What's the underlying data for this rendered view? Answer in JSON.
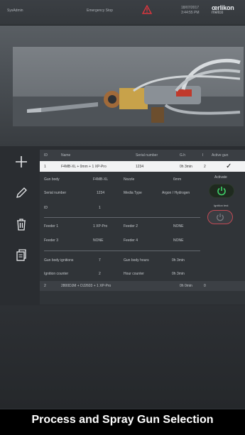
{
  "topbar": {
    "user": "SysAdmin",
    "emergency": "Emergency Stop",
    "date": "18/07/2017",
    "time": "3:44:55 PM",
    "logo_main": "œrlikon",
    "logo_sub": "metco"
  },
  "table": {
    "headers": {
      "id": "ID",
      "name": "Name",
      "serial": "Serial number",
      "hours": "G.h",
      "i": "I",
      "active": "Active gun"
    },
    "rows": [
      {
        "id": "1",
        "name": "F4MB-XL + 0mm + 1 XP-Pro",
        "serial": "1234",
        "hours": "0h 3min",
        "i": "2",
        "active": "✓"
      },
      {
        "id": "2",
        "name": "2800DJM + DJ2603 + 1 XP-Pro",
        "serial": "",
        "hours": "0h 0min",
        "i": "0",
        "active": ""
      }
    ]
  },
  "detail": {
    "gun_body_label": "Gun body",
    "gun_body_value": "F4MB-XL",
    "nozzle_label": "Nozzle",
    "nozzle_value": "6mm",
    "serial_label": "Serial number",
    "serial_value": "1234",
    "media_label": "Media Type",
    "media_value": "Argon / Hydrogen",
    "id_label": "ID",
    "id_value": "1",
    "feeder1_label": "Feeder 1",
    "feeder1_value": "1 XP-Pro",
    "feeder2_label": "Feeder 2",
    "feeder2_value": "NONE",
    "feeder3_label": "Feeder 3",
    "feeder3_value": "NONE",
    "feeder4_label": "Feeder 4",
    "feeder4_value": "NONE",
    "ignitions_label": "Gun body ignitions",
    "ignitions_value": "7",
    "gun_hours_label": "Gun body hours",
    "gun_hours_value": "0h 3min",
    "ign_counter_label": "Ignition counter",
    "ign_counter_value": "2",
    "hour_counter_label": "Hour counter",
    "hour_counter_value": "0h 3min"
  },
  "actions": {
    "activate": "Activate",
    "ignition_test": "Ignition test"
  },
  "caption": "Process and Spray Gun Selection",
  "colors": {
    "accent_green": "#3fd36a",
    "warning_red": "#d9363e",
    "ignition_red": "#c14a55"
  },
  "icons": [
    "add-icon",
    "edit-pencil-icon",
    "trash-icon",
    "copy-icon",
    "power-icon",
    "warning-triangle-icon",
    "checkmark-icon"
  ]
}
